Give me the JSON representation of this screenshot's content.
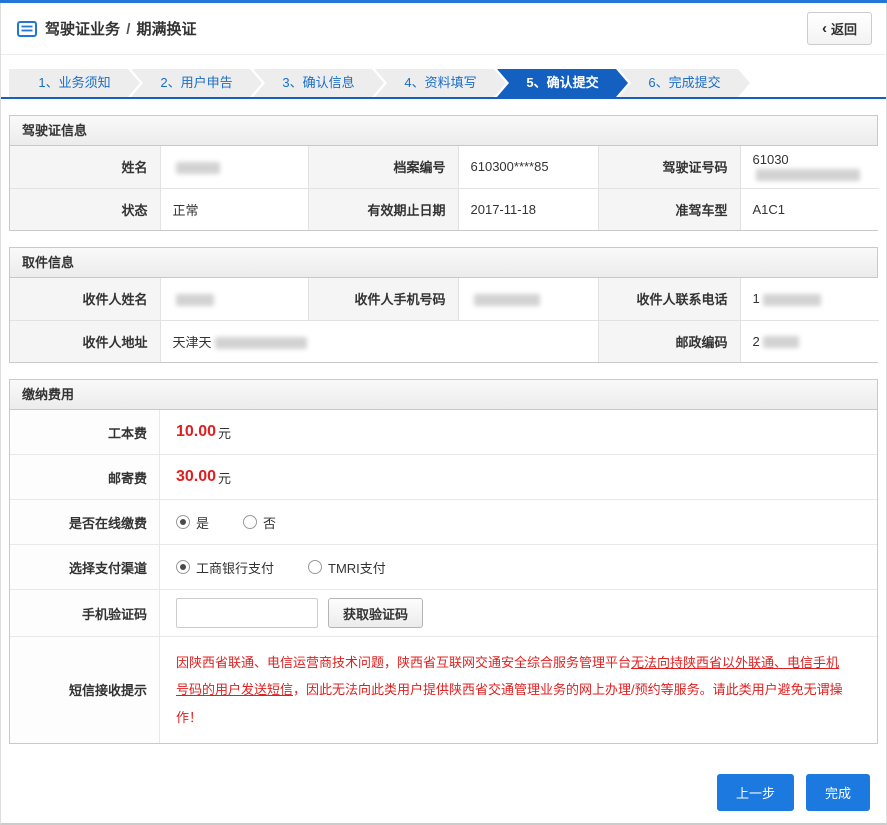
{
  "colors": {
    "topbar_blue": "#2176d8",
    "accent_blue": "#1360c0",
    "button_blue": "#1b79e0",
    "alert_red": "#e02020"
  },
  "header": {
    "title_business": "驾驶证业务",
    "title_separator": "/",
    "title_page": "期满换证",
    "back_chevron": "‹",
    "back_label": "返回"
  },
  "steps": [
    "1、业务须知",
    "2、用户申告",
    "3、确认信息",
    "4、资料填写",
    "5、确认提交",
    "6、完成提交"
  ],
  "license": {
    "title": "驾驶证信息",
    "name_label": "姓名",
    "file_no_label": "档案编号",
    "file_no_value": "610300****85",
    "license_no_label": "驾驶证号码",
    "license_no_prefix": "61030",
    "status_label": "状态",
    "status_value": "正常",
    "expiry_label": "有效期止日期",
    "expiry_value": "2017-11-18",
    "vehicle_label": "准驾车型",
    "vehicle_value": "A1C1"
  },
  "pickup": {
    "title": "取件信息",
    "recipient_name_label": "收件人姓名",
    "recipient_mobile_label": "收件人手机号码",
    "recipient_tel_label": "收件人联系电话",
    "recipient_tel_prefix": "1",
    "address_label": "收件人地址",
    "address_prefix": "天津天",
    "postcode_label": "邮政编码",
    "postcode_prefix": "2"
  },
  "fees": {
    "title": "缴纳费用",
    "production_fee_label": "工本费",
    "production_fee_value": "10.00",
    "postage_fee_label": "邮寄费",
    "postage_fee_value": "30.00",
    "currency": "元",
    "online_pay_label": "是否在线缴费",
    "online_pay_yes": "是",
    "online_pay_no": "否",
    "channel_label": "选择支付渠道",
    "channel_icbc": "工商银行支付",
    "channel_tmri": "TMRI支付",
    "sms_code_label": "手机验证码",
    "sms_code_button": "获取验证码",
    "sms_notice_label": "短信接收提示",
    "sms_notice": {
      "part1": "因陕西省联通、电信运营商技术问题，陕西省互联网交通安全综合服务管理平台",
      "underline": "无法向持陕西省以外联通、电信手机号码的用户发送短信",
      "part2": "，因此无法向此类用户提供陕西省交通管理业务的网上办理/预约等服务。请此类用户避免无谓操作！"
    }
  },
  "footer": {
    "prev_button": "上一步",
    "finish_button": "完成"
  }
}
